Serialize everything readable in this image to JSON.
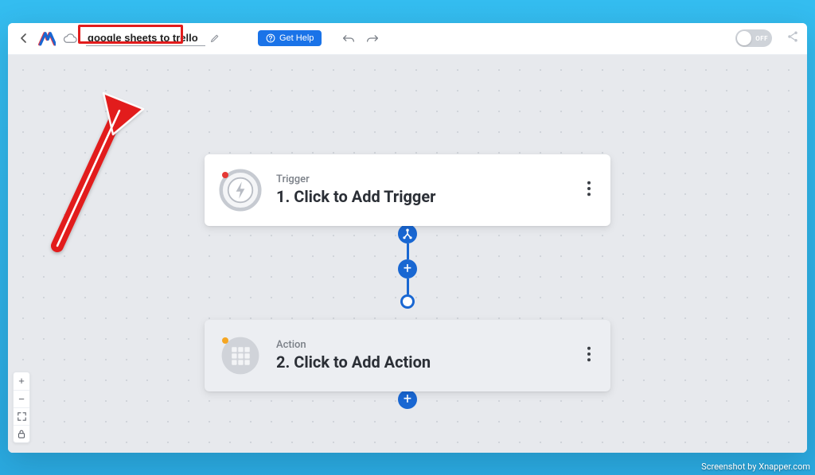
{
  "header": {
    "title_value": "google sheets to trello",
    "help_label": "Get Help",
    "toggle_state_label": "OFF"
  },
  "nodes": {
    "trigger": {
      "label": "Trigger",
      "title": "1. Click to Add Trigger",
      "status": "red"
    },
    "action": {
      "label": "Action",
      "title": "2. Click to Add Action",
      "status": "amber"
    }
  },
  "watermark": "Screenshot by Xnapper.com"
}
